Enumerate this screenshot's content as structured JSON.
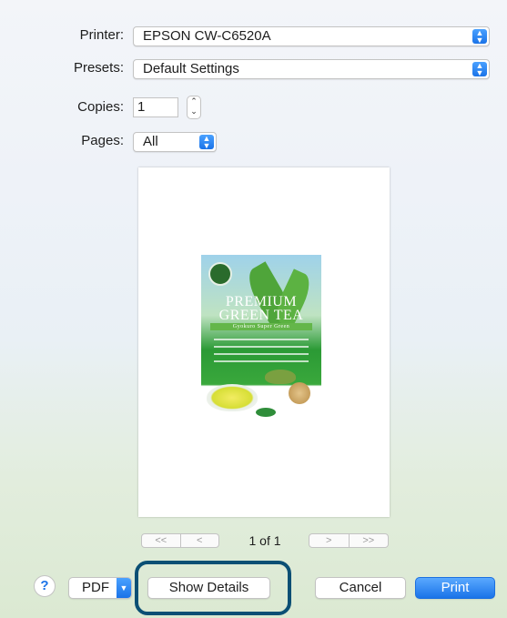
{
  "form": {
    "printer_label": "Printer:",
    "printer_value": "EPSON CW-C6520A",
    "presets_label": "Presets:",
    "presets_value": "Default Settings",
    "copies_label": "Copies:",
    "copies_value": "1",
    "pages_label": "Pages:",
    "pages_value": "All"
  },
  "preview": {
    "product_title_line1": "PREMIUM",
    "product_title_line2": "GREEN TEA",
    "product_subtitle": "Gyokuro Super Green"
  },
  "pager": {
    "first": "<<",
    "prev": "<",
    "page_count": "1 of 1",
    "next": ">",
    "last": ">>"
  },
  "buttons": {
    "help": "?",
    "pdf": "PDF",
    "show_details": "Show Details",
    "cancel": "Cancel",
    "print": "Print"
  },
  "colors": {
    "accent": "#1a73e8",
    "highlight_ring": "#0b4f74"
  },
  "icons": {
    "popup_arrow": "updown-chevron-icon",
    "stepper": "stepper-icon"
  }
}
